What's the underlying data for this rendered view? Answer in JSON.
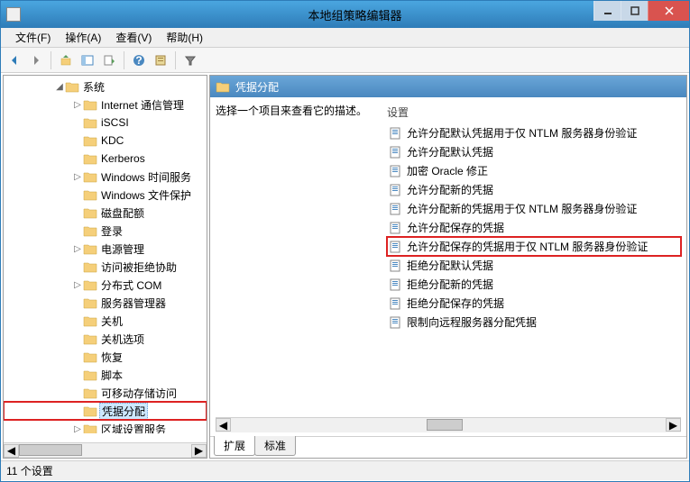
{
  "window": {
    "title": "本地组策略编辑器"
  },
  "menus": {
    "file": "文件(F)",
    "action": "操作(A)",
    "view": "查看(V)",
    "help": "帮助(H)"
  },
  "tree": {
    "root": "系统",
    "items": [
      {
        "label": "Internet 通信管理",
        "indent": 76,
        "expander": "▷"
      },
      {
        "label": "iSCSI",
        "indent": 76,
        "expander": ""
      },
      {
        "label": "KDC",
        "indent": 76,
        "expander": ""
      },
      {
        "label": "Kerberos",
        "indent": 76,
        "expander": ""
      },
      {
        "label": "Windows 时间服务",
        "indent": 76,
        "expander": "▷"
      },
      {
        "label": "Windows 文件保护",
        "indent": 76,
        "expander": ""
      },
      {
        "label": "磁盘配额",
        "indent": 76,
        "expander": ""
      },
      {
        "label": "登录",
        "indent": 76,
        "expander": ""
      },
      {
        "label": "电源管理",
        "indent": 76,
        "expander": "▷"
      },
      {
        "label": "访问被拒绝协助",
        "indent": 76,
        "expander": ""
      },
      {
        "label": "分布式 COM",
        "indent": 76,
        "expander": "▷"
      },
      {
        "label": "服务器管理器",
        "indent": 76,
        "expander": ""
      },
      {
        "label": "关机",
        "indent": 76,
        "expander": ""
      },
      {
        "label": "关机选项",
        "indent": 76,
        "expander": ""
      },
      {
        "label": "恢复",
        "indent": 76,
        "expander": ""
      },
      {
        "label": "脚本",
        "indent": 76,
        "expander": ""
      },
      {
        "label": "可移动存储访问",
        "indent": 76,
        "expander": ""
      },
      {
        "label": "凭据分配",
        "indent": 76,
        "expander": "",
        "selected": true
      },
      {
        "label": "区域设置服务",
        "indent": 76,
        "expander": "▷"
      }
    ]
  },
  "right": {
    "title": "凭据分配",
    "desc": "选择一个项目来查看它的描述。",
    "col_header": "设置",
    "settings": [
      {
        "label": "允许分配默认凭据用于仅 NTLM 服务器身份验证"
      },
      {
        "label": "允许分配默认凭据"
      },
      {
        "label": "加密 Oracle 修正"
      },
      {
        "label": "允许分配新的凭据"
      },
      {
        "label": "允许分配新的凭据用于仅 NTLM 服务器身份验证"
      },
      {
        "label": "允许分配保存的凭据"
      },
      {
        "label": "允许分配保存的凭据用于仅 NTLM 服务器身份验证",
        "hl": true
      },
      {
        "label": "拒绝分配默认凭据"
      },
      {
        "label": "拒绝分配新的凭据"
      },
      {
        "label": "拒绝分配保存的凭据"
      },
      {
        "label": "限制向远程服务器分配凭据"
      }
    ]
  },
  "tabs": {
    "ext": "扩展",
    "std": "标准"
  },
  "status": "11 个设置"
}
